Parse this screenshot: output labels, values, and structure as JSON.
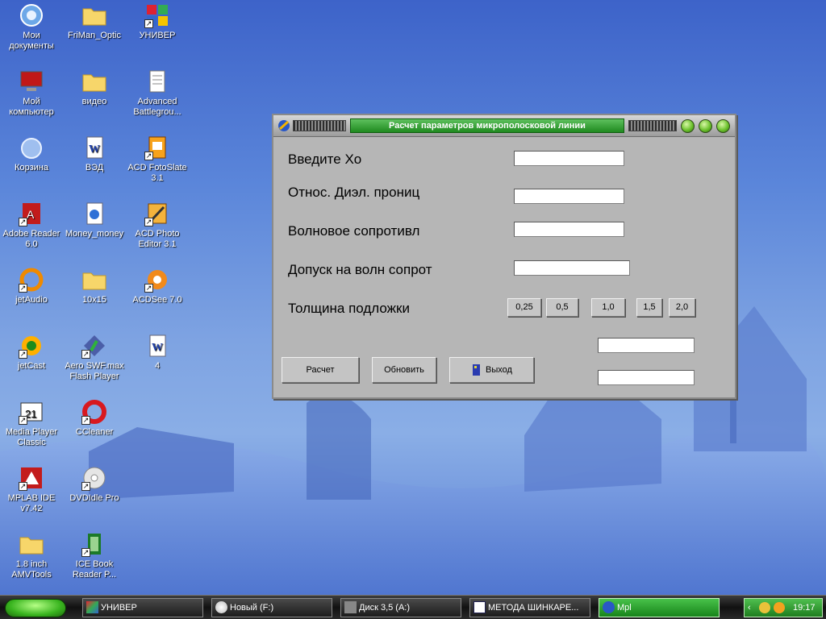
{
  "desktop": {
    "icons": [
      {
        "label": "Мои документы",
        "icon": "my-documents-icon"
      },
      {
        "label": "FriMan_Optic",
        "icon": "folder-icon"
      },
      {
        "label": "УНИВЕР",
        "icon": "univer-shortcut-icon"
      },
      {
        "label": "Мой компьютер",
        "icon": "my-computer-icon"
      },
      {
        "label": "видео",
        "icon": "folder-icon"
      },
      {
        "label": "Advanced Battlegrou...",
        "icon": "notepad-document-icon"
      },
      {
        "label": "Корзина",
        "icon": "recycle-bin-icon"
      },
      {
        "label": "ВЭД",
        "icon": "word-document-icon"
      },
      {
        "label": "ACD FotoSlate 3.1",
        "icon": "acd-fotoslate-icon"
      },
      {
        "label": "Adobe Reader 6.0",
        "icon": "adobe-reader-icon"
      },
      {
        "label": "Money_money",
        "icon": "media-file-icon"
      },
      {
        "label": "ACD Photo Editor 3.1",
        "icon": "acd-photo-editor-icon"
      },
      {
        "label": "jetAudio",
        "icon": "jetaudio-icon"
      },
      {
        "label": "10x15",
        "icon": "folder-icon"
      },
      {
        "label": "ACDSee 7.0",
        "icon": "acdsee-icon"
      },
      {
        "label": "jetCast",
        "icon": "jetcast-icon"
      },
      {
        "label": "Aero SWF.max Flash Player",
        "icon": "flash-player-icon"
      },
      {
        "label": "4",
        "icon": "word-document-icon"
      },
      {
        "label": "Media Player Classic",
        "icon": "media-player-classic-icon"
      },
      {
        "label": "CCleaner",
        "icon": "ccleaner-icon"
      },
      {
        "label": "MPLAB IDE v7.42",
        "icon": "mplab-icon"
      },
      {
        "label": "DVDIdle Pro",
        "icon": "dvd-icon"
      },
      {
        "label": "1.8 inch AMVTools",
        "icon": "folder-icon"
      },
      {
        "label": "ICE Book Reader P...",
        "icon": "ice-book-reader-icon"
      }
    ]
  },
  "window": {
    "title": "Расчет параметров микрополосковой линии",
    "labels": {
      "x0": "Введите  Xo",
      "eps": "Относ. Диэл. прониц",
      "impedance": "Волновое сопротивл",
      "tolerance": "Допуск на волн сопрот",
      "thickness": "Толщина подложки"
    },
    "fields": {
      "x0": "",
      "eps": "",
      "impedance": "",
      "tolerance": "",
      "result1": "",
      "result2": ""
    },
    "thickness_buttons": [
      "0,25",
      "0,5",
      "1,0",
      "1,5",
      "2,0"
    ],
    "buttons": {
      "calc": "Расчет",
      "refresh": "Обновить",
      "exit": "Выход"
    }
  },
  "taskbar": {
    "items": [
      {
        "label": "УНИВЕР",
        "active": false
      },
      {
        "label": "Новый (F:)",
        "active": false
      },
      {
        "label": "Диск 3,5 (A:)",
        "active": false
      },
      {
        "label": "МЕТОДА ШИНКАРЕ...",
        "active": false
      },
      {
        "label": "Mpl",
        "active": true
      }
    ],
    "clock": "19:17"
  },
  "colors": {
    "accent_green": "#2a9a2a",
    "window_gray": "#b6b6b6"
  }
}
